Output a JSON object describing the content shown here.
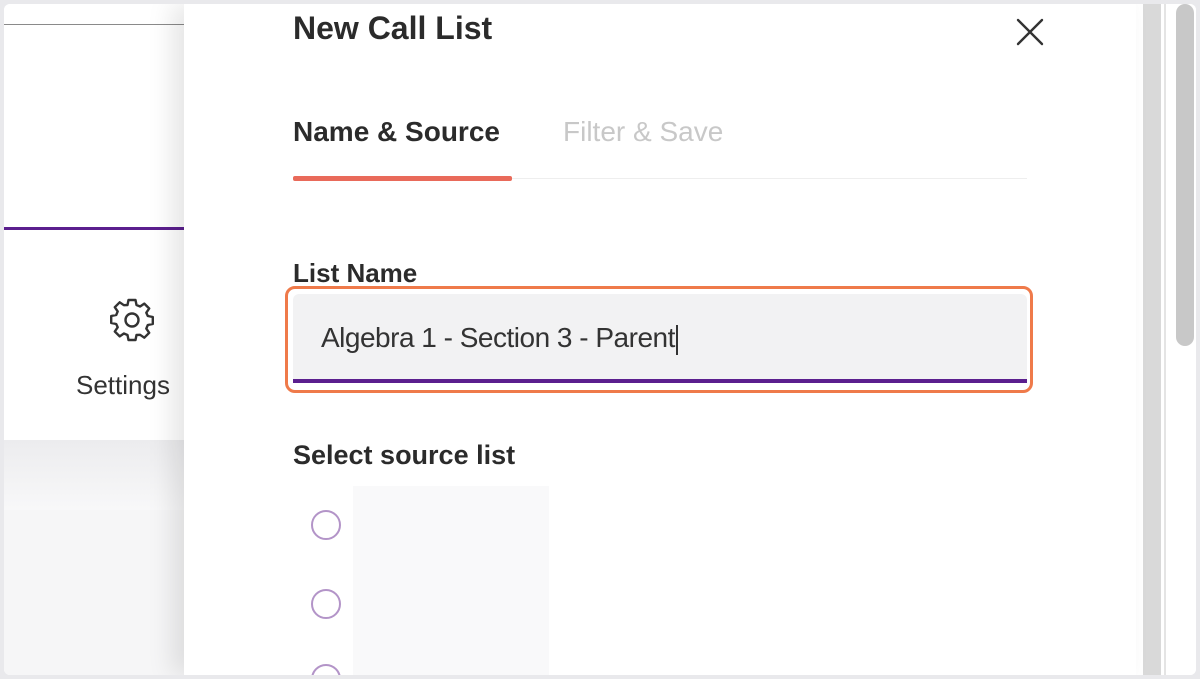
{
  "background_app": {
    "settings_label": "Settings",
    "settings_icon": "gear-icon"
  },
  "modal": {
    "title": "New Call List",
    "close_icon": "close-icon",
    "tabs": [
      {
        "label": "Name & Source",
        "active": true
      },
      {
        "label": "Filter & Save",
        "active": false
      }
    ],
    "list_name": {
      "label": "List Name",
      "value": "Algebra 1 - Section 3 - Parent"
    },
    "source": {
      "label": "Select source list",
      "options": [
        {
          "label": "",
          "selected": false
        },
        {
          "label": "",
          "selected": false
        },
        {
          "label": "",
          "selected": false
        }
      ]
    }
  },
  "colors": {
    "accent_purple": "#5b1f8e",
    "tab_indicator": "#e96a5a",
    "focus_ring": "#ef7a4a",
    "radio_border": "#b394c8"
  }
}
